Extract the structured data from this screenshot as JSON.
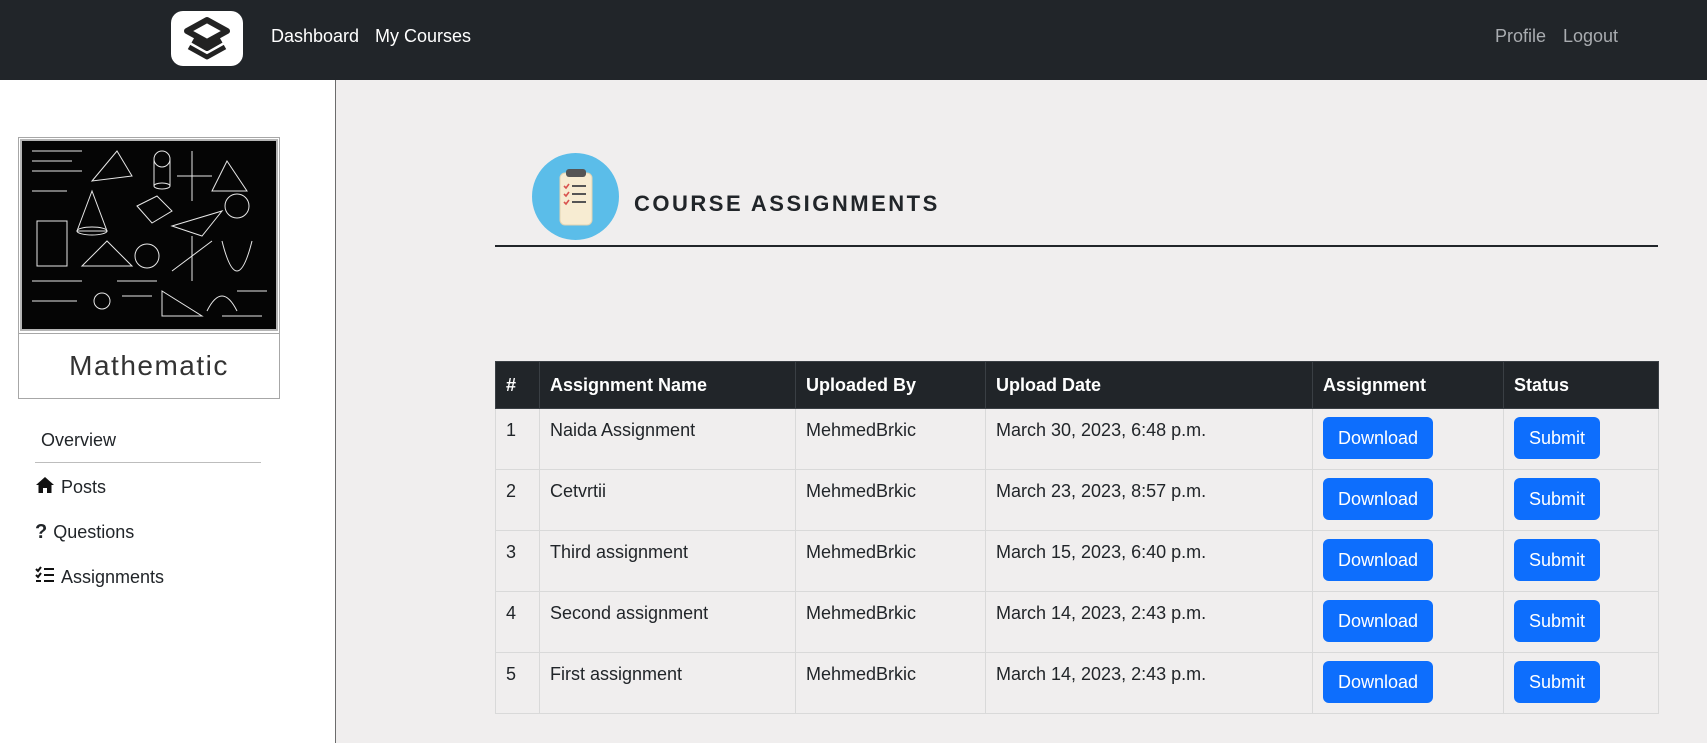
{
  "navbar": {
    "links": [
      "Dashboard",
      "My Courses"
    ],
    "right_links": [
      "Profile",
      "Logout"
    ]
  },
  "sidebar": {
    "course_title": "Mathematic",
    "overview": "Overview",
    "items": [
      {
        "label": "Posts",
        "icon": "home-icon"
      },
      {
        "label": "Questions",
        "icon": "question-icon"
      },
      {
        "label": "Assignments",
        "icon": "checklist-icon"
      }
    ]
  },
  "main": {
    "title": "COURSE ASSIGNMENTS",
    "table": {
      "headers": [
        "#",
        "Assignment Name",
        "Uploaded By",
        "Upload Date",
        "Assignment",
        "Status"
      ],
      "rows": [
        {
          "num": "1",
          "name": "Naida Assignment",
          "by": "MehmedBrkic",
          "date": "March 30, 2023, 6:48 p.m.",
          "download": "Download",
          "submit": "Submit"
        },
        {
          "num": "2",
          "name": "Cetvrtii",
          "by": "MehmedBrkic",
          "date": "March 23, 2023, 8:57 p.m.",
          "download": "Download",
          "submit": "Submit"
        },
        {
          "num": "3",
          "name": "Third assignment",
          "by": "MehmedBrkic",
          "date": "March 15, 2023, 6:40 p.m.",
          "download": "Download",
          "submit": "Submit"
        },
        {
          "num": "4",
          "name": "Second assignment",
          "by": "MehmedBrkic",
          "date": "March 14, 2023, 2:43 p.m.",
          "download": "Download",
          "submit": "Submit"
        },
        {
          "num": "5",
          "name": "First assignment",
          "by": "MehmedBrkic",
          "date": "March 14, 2023, 2:43 p.m.",
          "download": "Download",
          "submit": "Submit"
        }
      ]
    }
  },
  "colors": {
    "navbar": "#212529",
    "primary_button": "#0d6efd",
    "icon_circle": "#5bbde9",
    "page_bg": "#f0eeee"
  }
}
